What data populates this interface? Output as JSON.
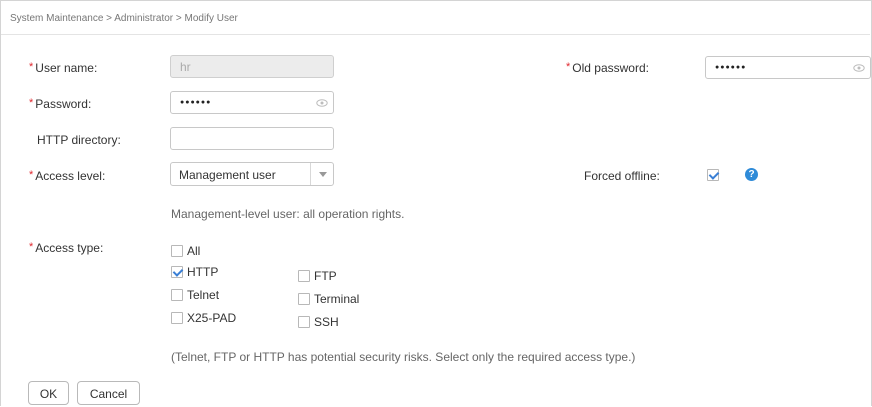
{
  "breadcrumb": "System Maintenance > Administrator > Modify User",
  "required_mark": "*",
  "form": {
    "user_name": {
      "label": "User name:",
      "value": "hr"
    },
    "old_password": {
      "label": "Old password:",
      "value": "●●●●●●"
    },
    "password": {
      "label": "Password:",
      "value": "●●●●●●"
    },
    "http_directory": {
      "label": "HTTP directory:",
      "value": ""
    },
    "access_level": {
      "label": "Access level:",
      "selected": "Management user"
    },
    "forced_offline": {
      "label": "Forced offline:",
      "checked": true
    },
    "access_level_hint": "Management-level user: all operation rights.",
    "access_type": {
      "label": "Access type:",
      "options": [
        {
          "label": "All",
          "checked": false
        },
        {
          "label": "HTTP",
          "checked": true
        },
        {
          "label": "FTP",
          "checked": false
        },
        {
          "label": "Telnet",
          "checked": false
        },
        {
          "label": "Terminal",
          "checked": false
        },
        {
          "label": "X25-PAD",
          "checked": false
        },
        {
          "label": "SSH",
          "checked": false
        }
      ]
    },
    "security_note": "(Telnet, FTP or HTTP has potential security risks. Select only the required access type.)"
  },
  "buttons": {
    "ok": "OK",
    "cancel": "Cancel"
  },
  "help_icon_glyph": "?",
  "colors": {
    "required": "#e0272d",
    "accent": "#3a7fd5",
    "help": "#2f8bd8"
  }
}
